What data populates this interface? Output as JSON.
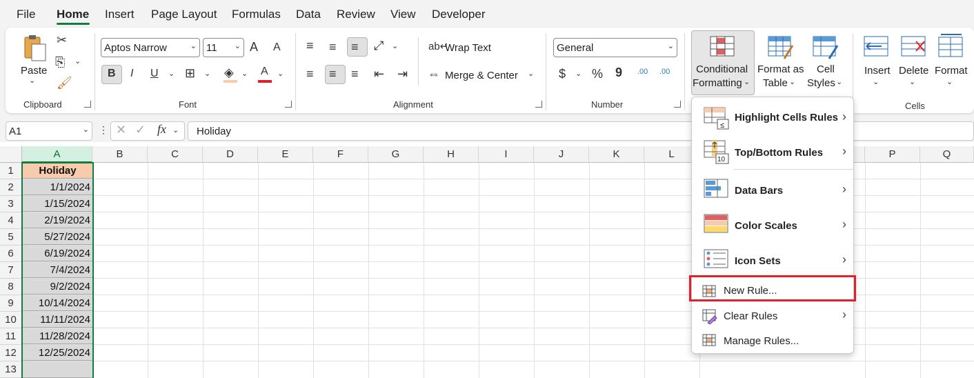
{
  "tabs": [
    "File",
    "Home",
    "Insert",
    "Page Layout",
    "Formulas",
    "Data",
    "Review",
    "View",
    "Developer"
  ],
  "active_tab": "Home",
  "clipboard": {
    "paste": "Paste",
    "group": "Clipboard"
  },
  "font": {
    "name": "Aptos Narrow",
    "size": "11",
    "bold": "B",
    "italic": "I",
    "underline": "U",
    "grow": "A",
    "shrink": "A",
    "color_letter": "A",
    "group": "Font"
  },
  "alignment": {
    "wrap": "Wrap Text",
    "merge": "Merge & Center",
    "group": "Alignment"
  },
  "number": {
    "format": "General",
    "currency": "$",
    "percent": "%",
    "comma": "9",
    "inc_decimal": ".00",
    "dec_decimal": ".00",
    "group": "Number"
  },
  "styles": {
    "cond_line1": "Conditional",
    "cond_line2": "Formatting",
    "table_line1": "Format as",
    "table_line2": "Table",
    "cell_line1": "Cell",
    "cell_line2": "Styles"
  },
  "cells": {
    "insert": "Insert",
    "delete": "Delete",
    "format": "Format",
    "group": "Cells"
  },
  "formula_bar": {
    "name_box": "A1",
    "fx": "fx",
    "content": "Holiday"
  },
  "columns": [
    "A",
    "B",
    "C",
    "D",
    "E",
    "F",
    "G",
    "H",
    "I",
    "J",
    "K",
    "L",
    "M",
    "N",
    "O",
    "P",
    "Q"
  ],
  "rows": [
    "1",
    "2",
    "3",
    "4",
    "5",
    "6",
    "7",
    "8",
    "9",
    "10",
    "11",
    "12",
    "13"
  ],
  "column_a": [
    "Holiday",
    "1/1/2024",
    "1/15/2024",
    "2/19/2024",
    "5/27/2024",
    "6/19/2024",
    "7/4/2024",
    "9/2/2024",
    "10/14/2024",
    "11/11/2024",
    "11/28/2024",
    "12/25/2024",
    ""
  ],
  "menu": {
    "highlight": "Highlight Cells Rules",
    "topbottom": "Top/Bottom Rules",
    "databars": "Data Bars",
    "colorscales": "Color Scales",
    "iconsets": "Icon Sets",
    "newrule": "New Rule...",
    "clearrules": "Clear Rules",
    "managerules": "Manage Rules..."
  },
  "colors": {
    "accent": "#107c41",
    "header_fill": "#f8cbad",
    "highlight_box": "#e0202a",
    "selection_fill": "#d9d9d9"
  }
}
